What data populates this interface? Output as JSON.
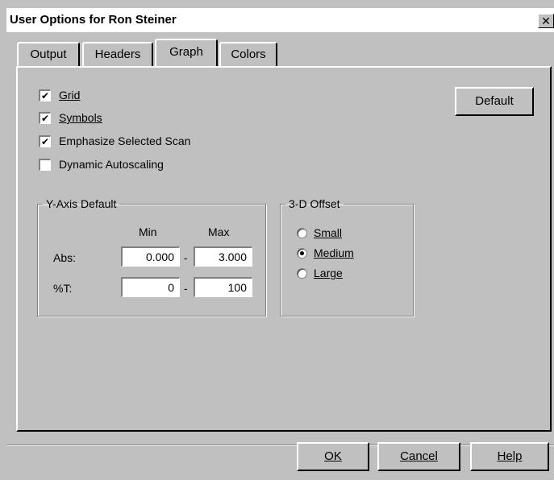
{
  "window": {
    "title": "User Options for Ron Steiner",
    "close_label": "✕"
  },
  "tabs": [
    {
      "label": "Output",
      "active": false
    },
    {
      "label": "Headers",
      "active": false
    },
    {
      "label": "Graph",
      "active": true
    },
    {
      "label": "Colors",
      "active": false
    }
  ],
  "checkboxes": [
    {
      "label": "Grid",
      "checked": true
    },
    {
      "label": "Symbols",
      "checked": true
    },
    {
      "label": "Emphasize Selected Scan",
      "checked": true
    },
    {
      "label": "Dynamic Autoscaling",
      "checked": false
    }
  ],
  "default_button": "Default",
  "yaxis": {
    "title": "Y-Axis Default",
    "min_header": "Min",
    "max_header": "Max",
    "dash": "-",
    "rows": [
      {
        "label": "Abs:",
        "min": "0.000",
        "max": "3.000"
      },
      {
        "label": "%T:",
        "min": "0",
        "max": "100"
      }
    ]
  },
  "offset": {
    "title": "3-D Offset",
    "options": [
      {
        "label": "Small",
        "selected": false
      },
      {
        "label": "Medium",
        "selected": true
      },
      {
        "label": "Large",
        "selected": false
      }
    ]
  },
  "footer": {
    "ok": "OK",
    "cancel": "Cancel",
    "help": "Help"
  }
}
